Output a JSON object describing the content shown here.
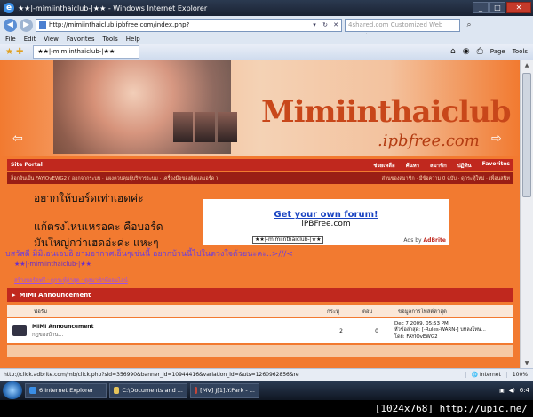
{
  "window": {
    "title": "★★|-mimiinthaiclub-|★★ - Windows Internet Explorer"
  },
  "address": {
    "url": "http://mimiinthaiclub.ipbfree.com/index.php?",
    "search_placeholder": "4shared.com Customized Web Search"
  },
  "menu": [
    "File",
    "Edit",
    "View",
    "Favorites",
    "Tools",
    "Help"
  ],
  "tab": {
    "label": "★★|-mimiinthaiclub-|★★"
  },
  "commands": {
    "page": "Page",
    "tools": "Tools"
  },
  "site": {
    "logo": "Mimiinthaiclub",
    "logo_sub": ".ipbfree.com",
    "redbar_left": "Site Portal",
    "redbar_right": [
      "ช่วยเหลือ",
      "ค้นหา",
      "สมาชิก",
      "ปฏิทิน",
      "Favorites"
    ],
    "subbar_left": "ล็อกอินเป็น FAYIOvEWG2 ( ออกจากระบบ · แผงควบคุมผู้บริหารระบบ · เครื่องมือของผู้ดูแลบอร์ด )",
    "subbar_right": "ส่วนของสมาชิก · มีข้อความ 0 ฉบับ · ดูกระทู้ใหม่ · เพื่อนสนิท",
    "thai_line1": "อยากให้บอร์ดเท่าเฮดค่ะ",
    "thai_line2": "แก้ตรงไหนเหรอคะ คือบอร์ด",
    "thai_line3": "มันใหญ่กว่าเฮดอ่ะค่ะ แหะๆ",
    "welcome": "บสวัสดี มิมิเอนเอบอิ ยามอากาศเย็นๆเช่นนี้ อยากบ้านนี้ไปในดวงใจด้วยนะคะ..>///<",
    "nav_crumb": "★★|-mimiinthaiclub-|★★",
    "nav_sub": "สร้างบอร์ดฟรี · ดูกระทู้ล่าสุด · ดูสมาชิกที่ออนไลน์"
  },
  "ad": {
    "headline": "Get your own forum!",
    "site": "iPBFree.com",
    "by_prefix": "Ads by",
    "by_brand": "AdBrite",
    "label": "★★|-mimiinthaiclub-|★★"
  },
  "forum": {
    "category": "MIMI Announcement",
    "columns": {
      "forum": "ฟอรัม",
      "topics": "กระทู้",
      "replies": "ตอบ",
      "last": "ข้อมูลการโพสต์ล่าสุด"
    },
    "rows": [
      {
        "name": "MIMI Announcement",
        "desc": "กฎของบ้าน...",
        "topics": "2",
        "replies": "0",
        "last_date": "Dec 7 2009, 05:53 PM",
        "last_topic": "หัวข้อล่าสุด: [-Rules-WARN-] บทลงโทษ...",
        "last_by": "โดย: FAYIOvEWG2"
      }
    ]
  },
  "status": {
    "url": "http://click.adbrite.com/mb/click.php?sid=356990&banner_id=10944416&variation_id=&uts=1260962856&re",
    "zone": "Internet",
    "zoom": "100%"
  },
  "taskbar": {
    "items": [
      "6 Internet Explorer",
      "C:\\Documents and ...",
      "[MV] J[1].Y.Park - ..."
    ],
    "clock": "6:4",
    "credit": "[1024x768] http://upic.me/"
  }
}
